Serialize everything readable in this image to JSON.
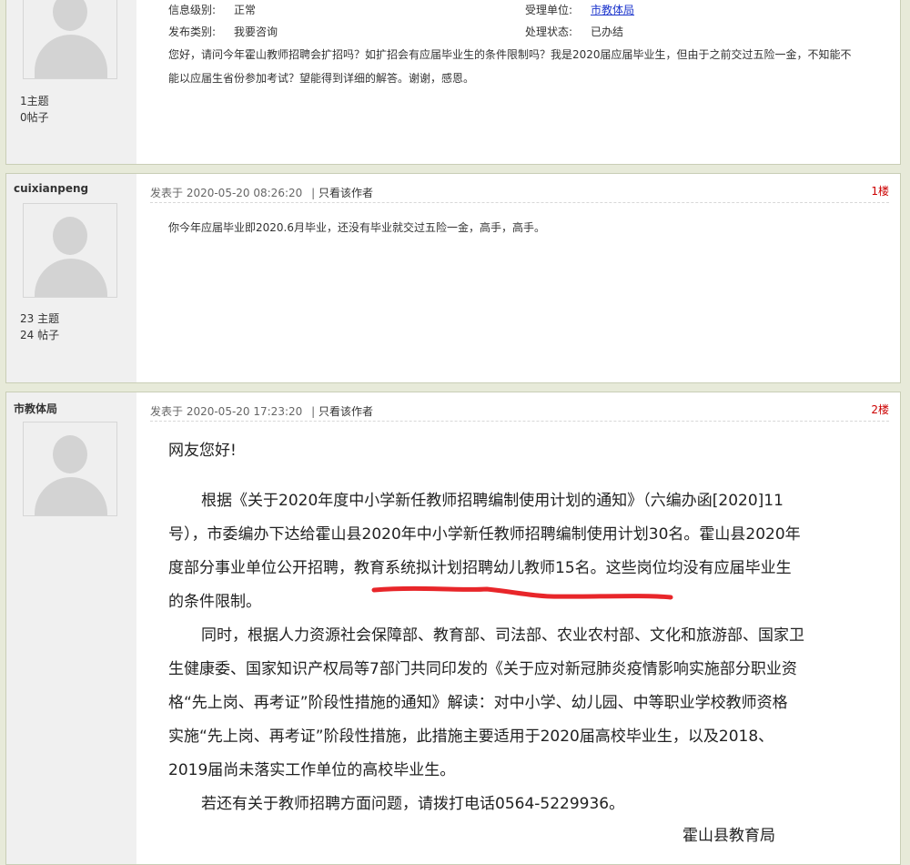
{
  "post0": {
    "stats": [
      "1主题",
      "0帖子"
    ],
    "info": {
      "level_label": "信息级别:",
      "level_value": "正常",
      "unit_label": "受理单位:",
      "unit_value": "市教体局",
      "type_label": "发布类别:",
      "type_value": "我要咨询",
      "status_label": "处理状态:",
      "status_value": "已办结"
    },
    "content_lines": [
      "您好，请问今年霍山教师招聘会扩招吗？如扩招会有应届毕业生的条件限制吗？我是2020届应届毕业生，但由于之前交过五险一金，不知能不",
      "能以应届生省份参加考试？望能得到详细的解答。谢谢，感恩。"
    ]
  },
  "post1": {
    "username": "cuixianpeng",
    "stats": [
      "23 主题",
      "24 帖子"
    ],
    "posted": "发表于 2020-05-20 08:26:20",
    "sep": "|",
    "only_author": "只看该作者",
    "floor": "1楼",
    "content": "你今年应届毕业即2020.6月毕业，还没有毕业就交过五险一金，高手，高手。"
  },
  "post2": {
    "username": "市教体局",
    "posted": "发表于 2020-05-20 17:23:20",
    "sep": "|",
    "only_author": "只看该作者",
    "floor": "2楼",
    "greeting": "网友您好!",
    "lines": [
      "根据《关于2020年度中小学新任教师招聘编制使用计划的通知》（六编办函[2020]11",
      "号），市委编办下达给霍山县2020年中小学新任教师招聘编制使用计划30名。霍山县2020年",
      "度部分事业单位公开招聘，教育系统拟计划招聘幼儿教师15名。这些岗位均没有应届毕业生",
      "的条件限制。",
      "同时，根据人力资源社会保障部、教育部、司法部、农业农村部、文化和旅游部、国家卫",
      "生健康委、国家知识产权局等7部门共同印发的《关于应对新冠肺炎疫情影响实施部分职业资",
      "格“先上岗、再考证”阶段性措施的通知》解读：对中小学、幼儿园、中等职业学校教师资格",
      "实施“先上岗、再考证”阶段性措施，此措施主要适用于2020届高校毕业生，以及2018、",
      "2019届尚未落实工作单位的高校毕业生。",
      "若还有关于教师招聘方面问题，请拨打电话0564-5229936。"
    ],
    "signature": "霍山县教育局"
  }
}
